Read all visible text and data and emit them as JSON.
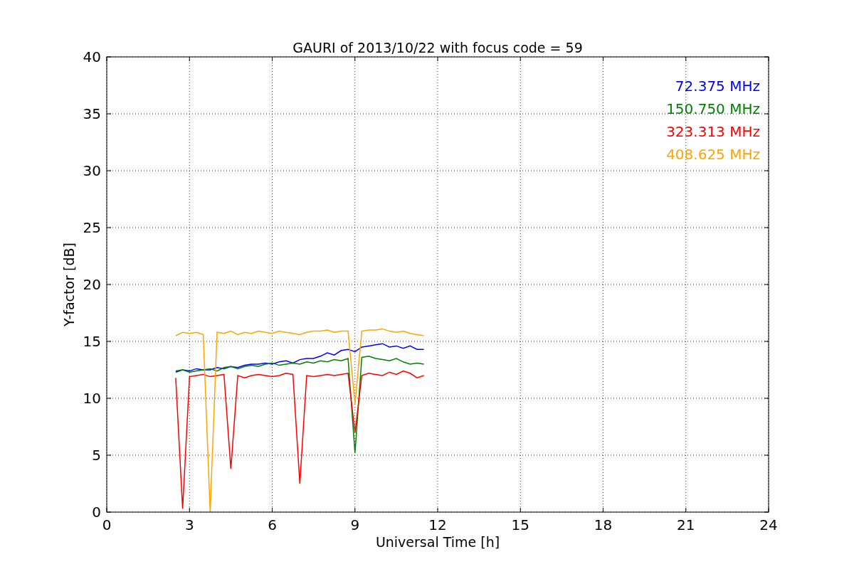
{
  "figure": {
    "chart_data": {
      "type": "line",
      "title": "GAURI of 2013/10/22 with focus code = 59",
      "xlabel": "Universal Time [h]",
      "ylabel": "Y-factor [dB]",
      "x": [
        2.5,
        2.75,
        3,
        3.25,
        3.5,
        3.75,
        4,
        4.25,
        4.5,
        4.75,
        5,
        5.25,
        5.5,
        5.75,
        6,
        6.25,
        6.5,
        6.75,
        7,
        7.25,
        7.5,
        7.75,
        8,
        8.25,
        8.5,
        8.75,
        9,
        9.25,
        9.5,
        9.75,
        10,
        10.25,
        10.5,
        10.75,
        11,
        11.25,
        11.5
      ],
      "series": [
        {
          "name": "72.375 MHz",
          "color": "#0000ff",
          "values": [
            12.3,
            12.5,
            12.4,
            12.6,
            12.5,
            12.5,
            12.7,
            12.6,
            12.8,
            12.7,
            12.9,
            13.0,
            13.0,
            13.1,
            13.0,
            13.2,
            13.3,
            13.1,
            13.4,
            13.5,
            13.5,
            13.7,
            14.0,
            13.8,
            14.2,
            14.3,
            14.1,
            14.5,
            14.6,
            14.7,
            14.8,
            14.5,
            14.6,
            14.4,
            14.6,
            14.3,
            14.3
          ]
        },
        {
          "name": "150.750 MHz",
          "color": "#008000",
          "values": [
            12.4,
            12.5,
            12.3,
            12.4,
            12.5,
            12.6,
            12.4,
            12.7,
            12.8,
            12.6,
            12.8,
            12.9,
            12.8,
            13.0,
            13.1,
            12.9,
            13.0,
            13.1,
            13.0,
            13.2,
            13.1,
            13.3,
            13.2,
            13.4,
            13.3,
            13.5,
            5.2,
            13.6,
            13.7,
            13.5,
            13.4,
            13.3,
            13.5,
            13.2,
            13.0,
            13.1,
            13.0
          ]
        },
        {
          "name": "323.313 MHz",
          "color": "#ff0000",
          "values": [
            11.8,
            0.3,
            11.9,
            12.0,
            12.1,
            11.9,
            12.0,
            12.1,
            3.8,
            12.0,
            11.8,
            12.0,
            12.1,
            12.0,
            11.9,
            12.0,
            12.2,
            12.1,
            2.5,
            12.0,
            11.9,
            12.0,
            12.1,
            12.0,
            12.1,
            12.2,
            7.0,
            12.0,
            12.2,
            12.1,
            12.0,
            12.3,
            12.1,
            12.4,
            12.2,
            11.8,
            12.0
          ]
        },
        {
          "name": "408.625 MHz",
          "color": "#ffa500",
          "values": [
            15.5,
            15.8,
            15.7,
            15.8,
            15.6,
            0.0,
            15.8,
            15.7,
            15.9,
            15.6,
            15.8,
            15.7,
            15.9,
            15.8,
            15.7,
            15.9,
            15.8,
            15.7,
            15.6,
            15.8,
            15.9,
            15.9,
            16.0,
            15.8,
            15.9,
            15.9,
            9.5,
            15.9,
            16.0,
            16.0,
            16.1,
            15.9,
            15.8,
            15.9,
            15.7,
            15.6,
            15.5
          ]
        }
      ],
      "xlim": [
        0,
        24
      ],
      "ylim": [
        0,
        40
      ],
      "xticks": [
        0,
        3,
        6,
        9,
        12,
        15,
        18,
        21,
        24
      ],
      "yticks": [
        0,
        5,
        10,
        15,
        20,
        25,
        30,
        35,
        40
      ],
      "grid": true
    }
  }
}
